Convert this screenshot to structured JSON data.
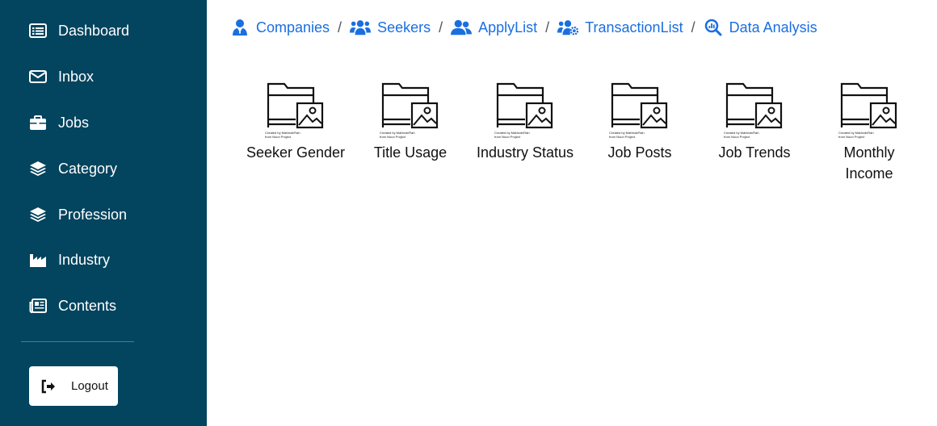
{
  "sidebar": {
    "items": [
      {
        "label": "Dashboard",
        "icon": "list-alt-icon"
      },
      {
        "label": "Inbox",
        "icon": "envelope-icon"
      },
      {
        "label": "Jobs",
        "icon": "briefcase-icon"
      },
      {
        "label": "Category",
        "icon": "layers-icon"
      },
      {
        "label": "Profession",
        "icon": "layers-icon"
      },
      {
        "label": "Industry",
        "icon": "industry-icon"
      },
      {
        "label": "Contents",
        "icon": "newspaper-icon"
      }
    ],
    "logout_label": "Logout"
  },
  "breadcrumb": [
    {
      "label": "Companies",
      "icon": "user-tie-icon"
    },
    {
      "label": "Seekers",
      "icon": "users-icon"
    },
    {
      "label": "ApplyList",
      "icon": "user-group-icon"
    },
    {
      "label": "TransactionList",
      "icon": "users-cog-icon"
    },
    {
      "label": "Data Analysis",
      "icon": "search-chart-icon"
    }
  ],
  "breadcrumb_separator": "/",
  "tiles": [
    {
      "label": "Seeker Gender",
      "credit_line1": "Created by Mahbub/Rah",
      "credit_line2": "from Noun Project"
    },
    {
      "label": "Title Usage",
      "credit_line1": "Created by Mahbub/Rah",
      "credit_line2": "from Noun Project"
    },
    {
      "label": "Industry Status",
      "credit_line1": "Created by Mahbub/Rah",
      "credit_line2": "from Noun Project"
    },
    {
      "label": "Job Posts",
      "credit_line1": "Created by Mahbub/Rah",
      "credit_line2": "from Noun Project"
    },
    {
      "label": "Job Trends",
      "credit_line1": "Created by Mahbub/Rah",
      "credit_line2": "from Noun Project"
    },
    {
      "label": "Monthly Income",
      "credit_line1": "Created by Mahbub/Rah",
      "credit_line2": "from Noun Project"
    }
  ],
  "colors": {
    "sidebar_bg": "#03445e",
    "link": "#1a6fe0"
  }
}
